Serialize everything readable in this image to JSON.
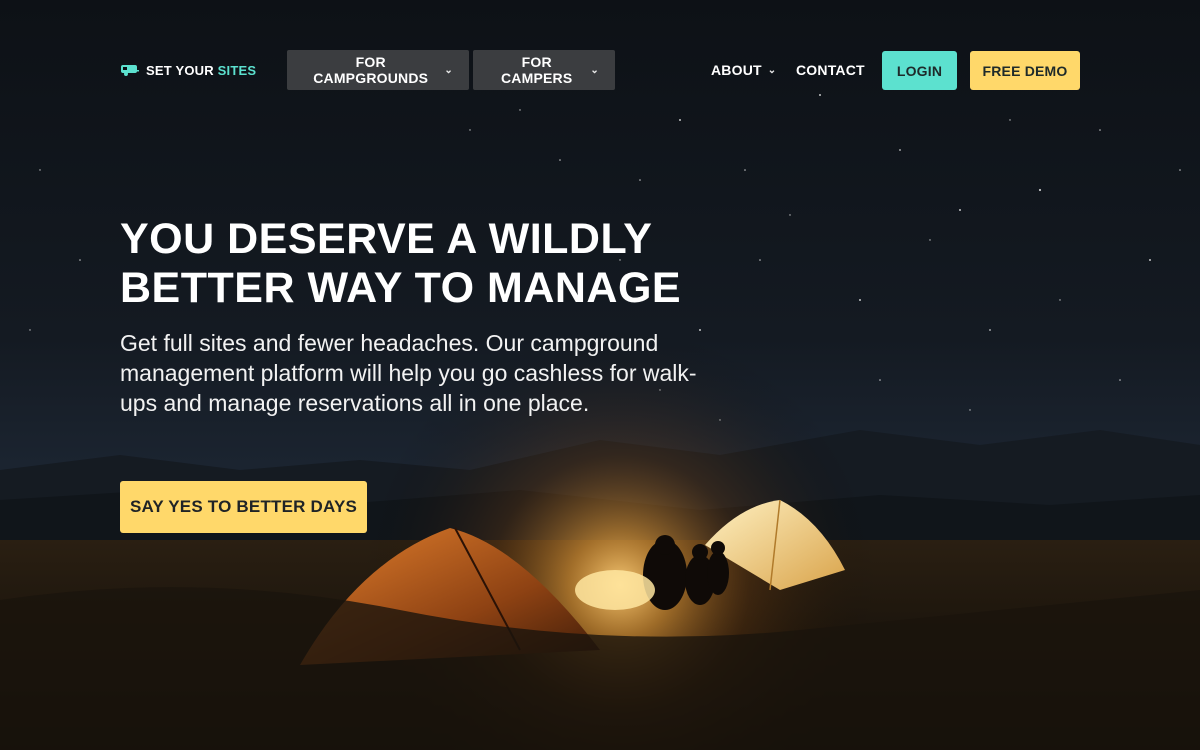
{
  "brand": {
    "name_prefix": "SET YOUR ",
    "name_accent": "SITES",
    "accent_color": "#5ce1cf"
  },
  "nav": {
    "campgrounds_label": "FOR CAMPGROUNDS",
    "campers_label": "FOR CAMPERS",
    "about_label": "ABOUT",
    "contact_label": "CONTACT",
    "login_label": "LOGIN",
    "demo_label": "FREE DEMO",
    "caret_glyph": "⌄"
  },
  "hero": {
    "headline_line1": "YOU DESERVE A WILDLY",
    "headline_line2": "BETTER WAY TO MANAGE",
    "subcopy": "Get full sites and fewer headaches. Our campground management platform will help you go cashless for walk-ups and manage reservations all in one place.",
    "cta_label": "SAY YES TO BETTER DAYS"
  },
  "colors": {
    "login_bg": "#5ce1cf",
    "demo_bg": "#ffd86a",
    "cta_bg": "#ffd86a",
    "menu_bg": "#3b3d40"
  }
}
